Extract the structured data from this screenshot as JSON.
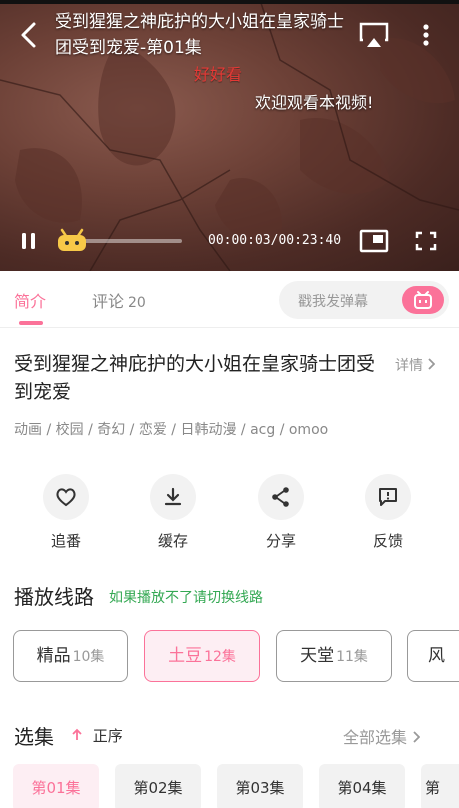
{
  "player": {
    "title": "受到猩猩之神庇护的大小姐在皇家骑士团受到宠爱-第01集",
    "danmaku": [
      "好好看",
      "欢迎观看本视频!"
    ],
    "time": "00:00:03/00:23:40",
    "progress": 0.002
  },
  "tabs": {
    "intro": "简介",
    "comments": "评论",
    "comments_count": "20",
    "danmaku_placeholder": "戳我发弹幕"
  },
  "info": {
    "title": "受到猩猩之神庇护的大小姐在皇家骑士团受到宠爱",
    "details": "详情",
    "tags": "动画 / 校园 / 奇幻 / 恋爱 / 日韩动漫 / acg / omoo"
  },
  "actions": [
    {
      "label": "追番",
      "icon": "heart-icon"
    },
    {
      "label": "缓存",
      "icon": "download-icon"
    },
    {
      "label": "分享",
      "icon": "share-icon"
    },
    {
      "label": "反馈",
      "icon": "feedback-icon"
    }
  ],
  "routes": {
    "title": "播放线路",
    "hint": "如果播放不了请切换线路",
    "items": [
      {
        "name": "精品",
        "count": "10集"
      },
      {
        "name": "土豆",
        "count": "12集"
      },
      {
        "name": "天堂",
        "count": "11集"
      },
      {
        "name": "风",
        "count": ""
      }
    ]
  },
  "episodes": {
    "title": "选集",
    "order": "正序",
    "all": "全部选集",
    "items": [
      "第01集",
      "第02集",
      "第03集",
      "第04集",
      "第"
    ]
  },
  "colors": {
    "accent": "#fb7299",
    "hint": "#34a853"
  }
}
